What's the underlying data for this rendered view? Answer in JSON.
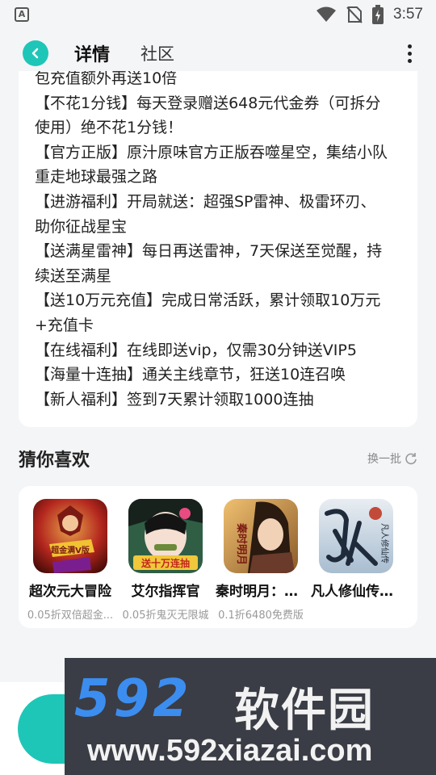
{
  "status_bar": {
    "notification_icon": "A",
    "time": "3:57"
  },
  "header": {
    "tabs": [
      {
        "label": "详情",
        "active": true
      },
      {
        "label": "社区",
        "active": false
      }
    ]
  },
  "description": {
    "lines": [
      "包充值额外再送10倍",
      "【不花1分钱】每天登录赠送648元代金券（可拆分",
      "使用）绝不花1分钱！",
      "【官方正版】原汁原味官方正版吞噬星空，集结小队",
      "重走地球最强之路",
      "【进游福利】开局就送：超强SP雷神、极雷环刃、",
      "助你征战星宝",
      "【送满星雷神】每日再送雷神，7天保送至觉醒，持",
      "续送至满星",
      "【送10万元充值】完成日常活跃，累计领取10万元",
      "+充值卡",
      "【在线福利】在线即送vip，仅需30分钟送VIP5",
      "【海量十连抽】通关主线章节，狂送10连召唤",
      "【新人福利】签到7天累计领取1000连抽"
    ]
  },
  "recommend": {
    "title": "猜你喜欢",
    "refresh_label": "换一批",
    "games": [
      {
        "name": "超次元大冒险",
        "sub": "0.05折双倍超金...",
        "icon_text": "超金满V版"
      },
      {
        "name": "艾尔指挥官",
        "sub": "0.05折鬼灭无限城",
        "icon_text": "送十万连抽"
      },
      {
        "name": "秦时明月：沧...",
        "sub": "0.1折6480免费版",
        "icon_text": "秦时明月"
      },
      {
        "name": "凡人修仙传：...",
        "sub": "",
        "icon_text": "凡人修仙传"
      }
    ]
  },
  "watermark": {
    "brand_num": "592",
    "brand_cn": "软件园",
    "url": "www.592xiazai.com"
  },
  "colors": {
    "accent": "#1ec6b8",
    "background": "#f4f5f7"
  }
}
